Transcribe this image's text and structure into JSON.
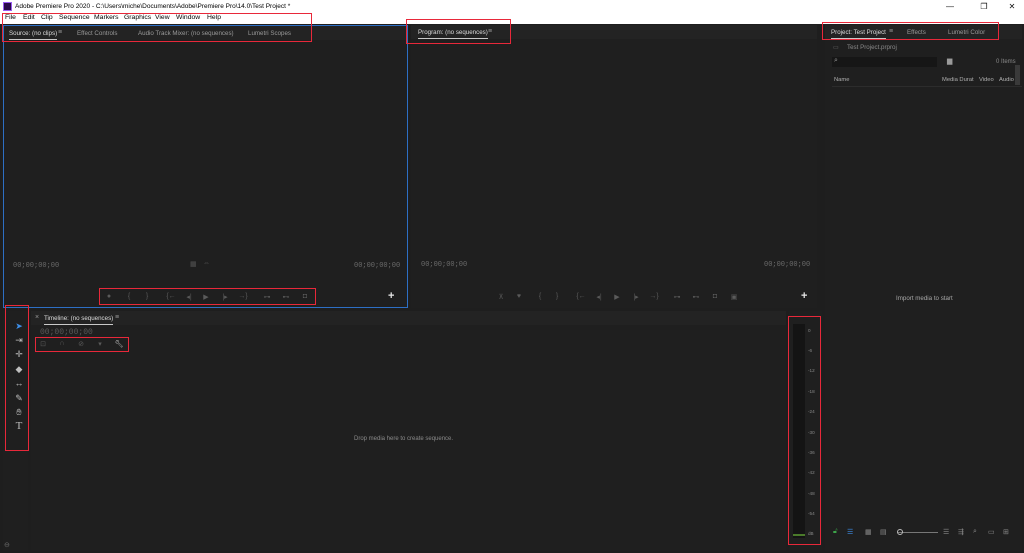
{
  "window": {
    "title": "Adobe Premiere Pro 2020 - C:\\Users\\miche\\Documents\\Adobe\\Premiere Pro\\14.0\\Test Project *",
    "minimize": "—",
    "maximize": "❐",
    "close": "✕"
  },
  "menubar": [
    "File",
    "Edit",
    "Clip",
    "Sequence",
    "Markers",
    "Graphics",
    "View",
    "Window",
    "Help"
  ],
  "source_panel": {
    "tabs": [
      "Source: (no clips)",
      "Effect Controls",
      "Audio Track Mixer: (no sequences)",
      "Lumetri Scopes"
    ],
    "timecode_in": "00;00;00;00",
    "timecode_out": "00;00;00;00",
    "controls": [
      "mark-in",
      "mark-out",
      "go-to-in",
      "step-back",
      "play",
      "step-forward",
      "go-to-out",
      "insert",
      "overwrite",
      "export-frame"
    ]
  },
  "program_panel": {
    "tab": "Program: (no sequences)",
    "timecode_in": "00;00;00;00",
    "timecode_out": "00;00;00;00"
  },
  "project_panel": {
    "tabs": [
      "Project: Test Project",
      "Effects",
      "Lumetri Color"
    ],
    "file": "Test Project.prproj",
    "item_count": "0 Items",
    "columns": [
      "Name",
      "Media Durat",
      "Video",
      "Audio"
    ],
    "empty_message": "Import media to start"
  },
  "timeline_panel": {
    "tab": "Timeline: (no sequences)",
    "close": "×",
    "timecode": "00;00;00;00",
    "empty_message": "Drop media here to create sequence."
  },
  "meter": {
    "ticks": [
      "0",
      "-6",
      "-12",
      "-18",
      "-24",
      "-30",
      "-36",
      "-42",
      "-48",
      "-54",
      "dB"
    ]
  },
  "tools": [
    "selection-tool",
    "track-select-tool",
    "ripple-edit-tool",
    "razor-tool",
    "slip-tool",
    "pen-tool",
    "hand-tool",
    "type-tool"
  ],
  "colors": {
    "highlight": "#e8283a",
    "selected_tool": "#3d8ee8",
    "panel_bg": "#1f1f1f"
  }
}
